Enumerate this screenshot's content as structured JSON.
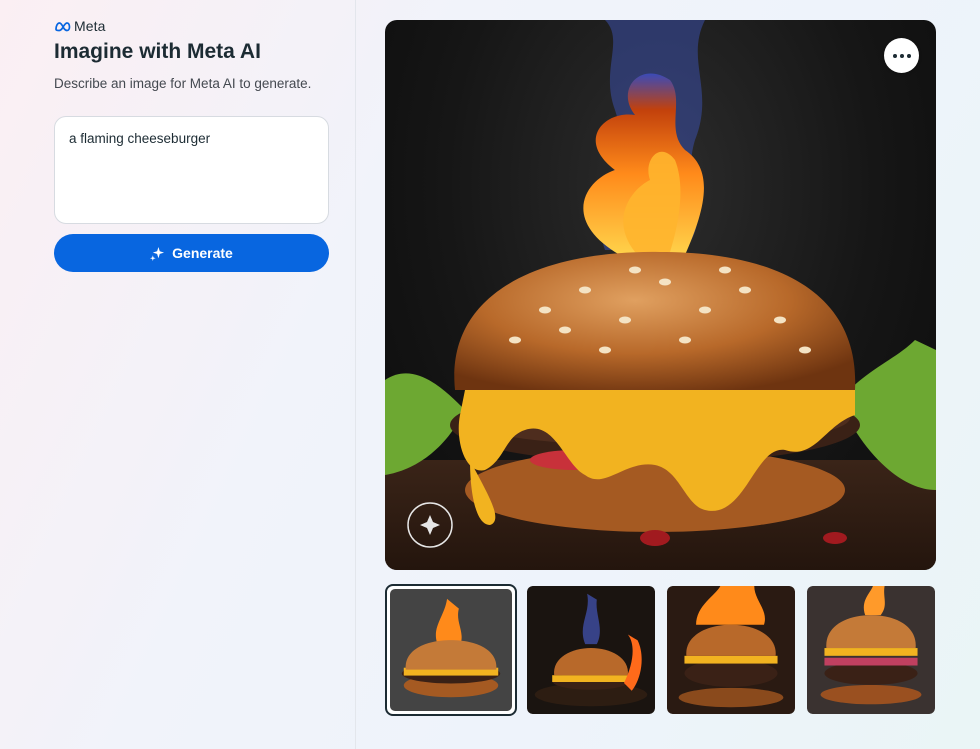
{
  "brand": {
    "name": "Meta",
    "logo_icon": "meta-infinity-icon"
  },
  "page": {
    "title": "Imagine with Meta AI",
    "subtitle": "Describe an image for Meta AI to generate."
  },
  "prompt": {
    "value": "a flaming cheeseburger"
  },
  "generate_button": {
    "label": "Generate",
    "icon": "sparkle-icon"
  },
  "result": {
    "image_description_icon": "generated-image",
    "watermark_icon": "imagined-with-ai-watermark",
    "more_options_icon": "more-horizontal-icon"
  },
  "thumbnails": [
    {
      "selected": true
    },
    {
      "selected": false
    },
    {
      "selected": false
    },
    {
      "selected": false
    }
  ],
  "colors": {
    "accent": "#0866e0",
    "text": "#1c2b33"
  }
}
